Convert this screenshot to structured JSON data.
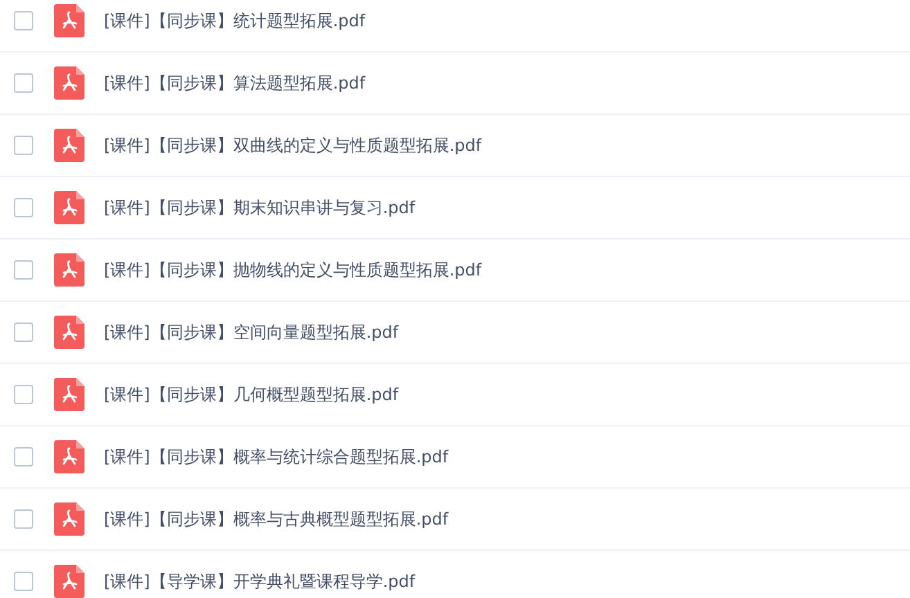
{
  "files": [
    {
      "name": "[课件]【同步课】统计题型拓展.pdf",
      "checked": false
    },
    {
      "name": "[课件]【同步课】算法题型拓展.pdf",
      "checked": false
    },
    {
      "name": "[课件]【同步课】双曲线的定义与性质题型拓展.pdf",
      "checked": false
    },
    {
      "name": "[课件]【同步课】期末知识串讲与复习.pdf",
      "checked": false
    },
    {
      "name": "[课件]【同步课】抛物线的定义与性质题型拓展.pdf",
      "checked": false
    },
    {
      "name": "[课件]【同步课】空间向量题型拓展.pdf",
      "checked": false
    },
    {
      "name": "[课件]【同步课】几何概型题型拓展.pdf",
      "checked": false
    },
    {
      "name": "[课件]【同步课】概率与统计综合题型拓展.pdf",
      "checked": false
    },
    {
      "name": "[课件]【同步课】概率与古典概型题型拓展.pdf",
      "checked": false
    },
    {
      "name": "[课件]【导学课】开学典礼暨课程导学.pdf",
      "checked": false
    }
  ]
}
